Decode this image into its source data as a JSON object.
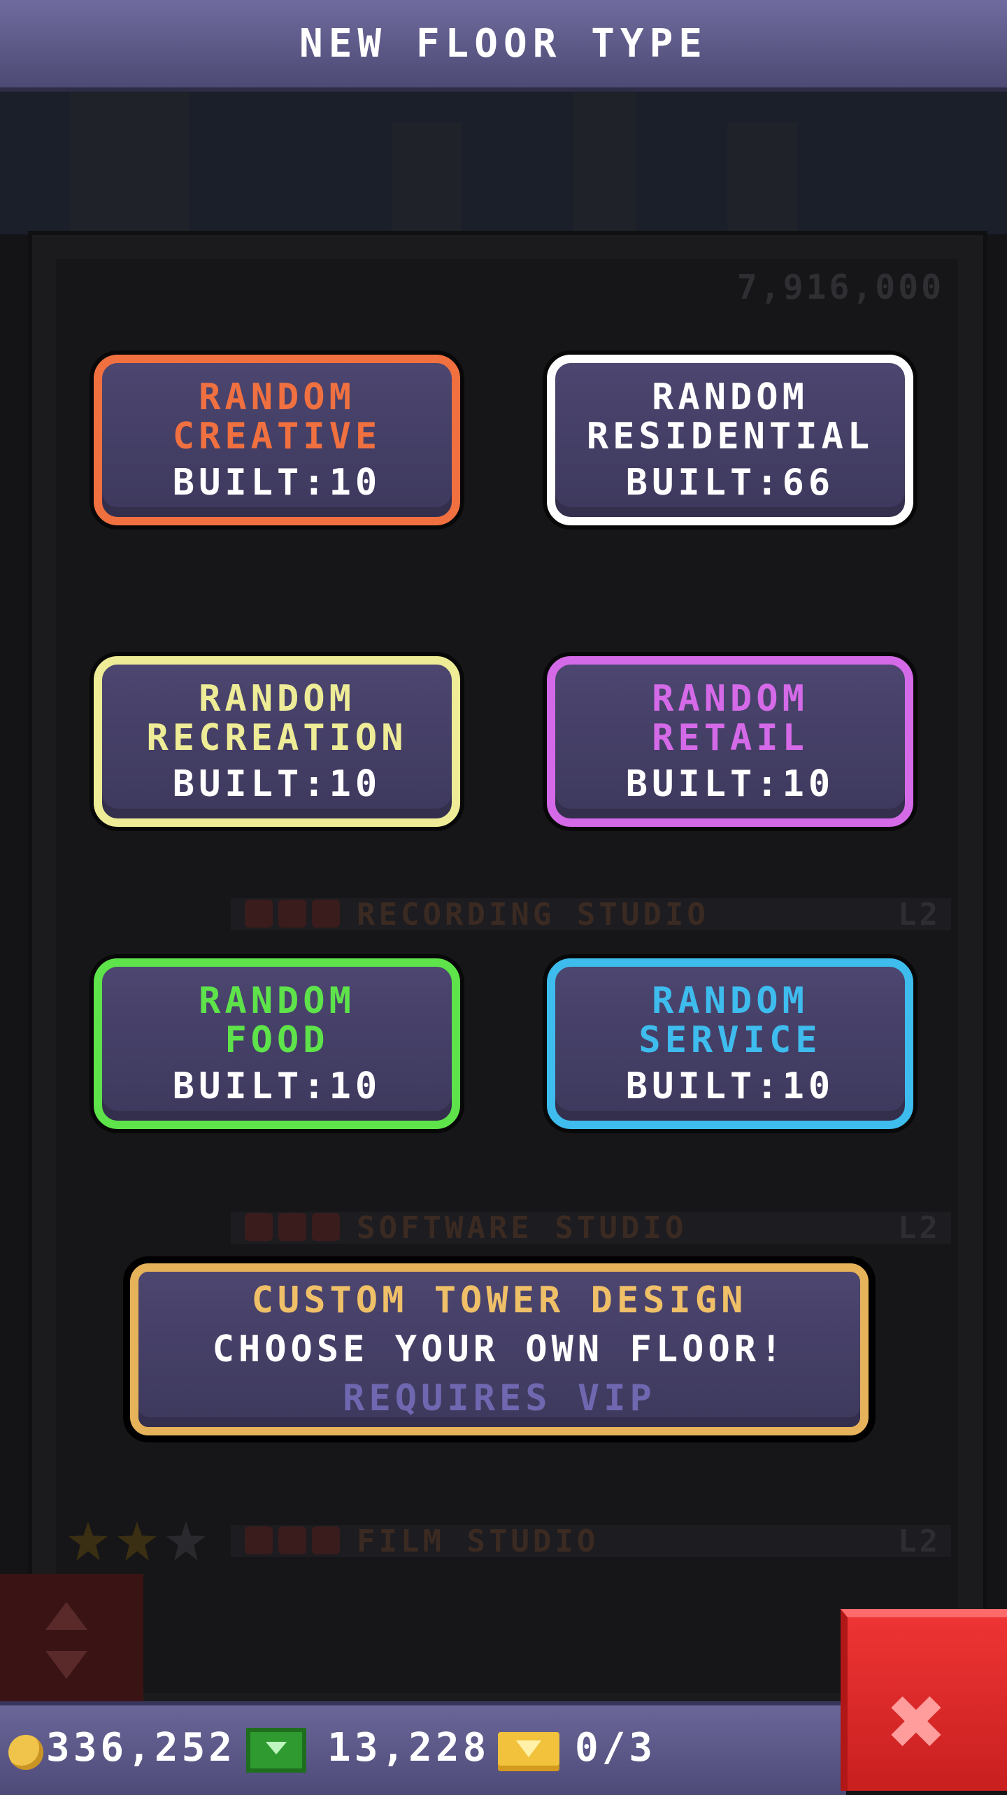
{
  "header": {
    "title": "NEW FLOOR TYPE"
  },
  "background": {
    "tower_count": "7,916,000",
    "floors": [
      {
        "name": "RECORDING STUDIO",
        "level": "L2"
      },
      {
        "name": "SOFTWARE STUDIO",
        "level": "L2"
      },
      {
        "name": "FILM STUDIO",
        "level": "L2"
      }
    ]
  },
  "cards": [
    {
      "line1": "RANDOM",
      "line2": "CREATIVE",
      "built": "BUILT:10",
      "color": "#f07040"
    },
    {
      "line1": "RANDOM",
      "line2": "RESIDENTIAL",
      "built": "BUILT:66",
      "color": "#ffffff"
    },
    {
      "line1": "RANDOM",
      "line2": "RECREATION",
      "built": "BUILT:10",
      "color": "#eeec96"
    },
    {
      "line1": "RANDOM",
      "line2": "RETAIL",
      "built": "BUILT:10",
      "color": "#d56ae8"
    },
    {
      "line1": "RANDOM",
      "line2": "FOOD",
      "built": "BUILT:10",
      "color": "#5ee34a"
    },
    {
      "line1": "RANDOM",
      "line2": "SERVICE",
      "built": "BUILT:10",
      "color": "#3ebcee"
    }
  ],
  "custom": {
    "title": "CUSTOM TOWER DESIGN",
    "subtitle": "CHOOSE YOUR OWN FLOOR!",
    "requirement": "REQUIRES VIP",
    "color": "#e6b25a"
  },
  "status": {
    "coins": "336,252",
    "bux": "13,228",
    "tickets": "0/3"
  },
  "icons": [
    "coin-icon",
    "bux-icon",
    "ticket-icon",
    "close-icon",
    "elevator-icon"
  ]
}
